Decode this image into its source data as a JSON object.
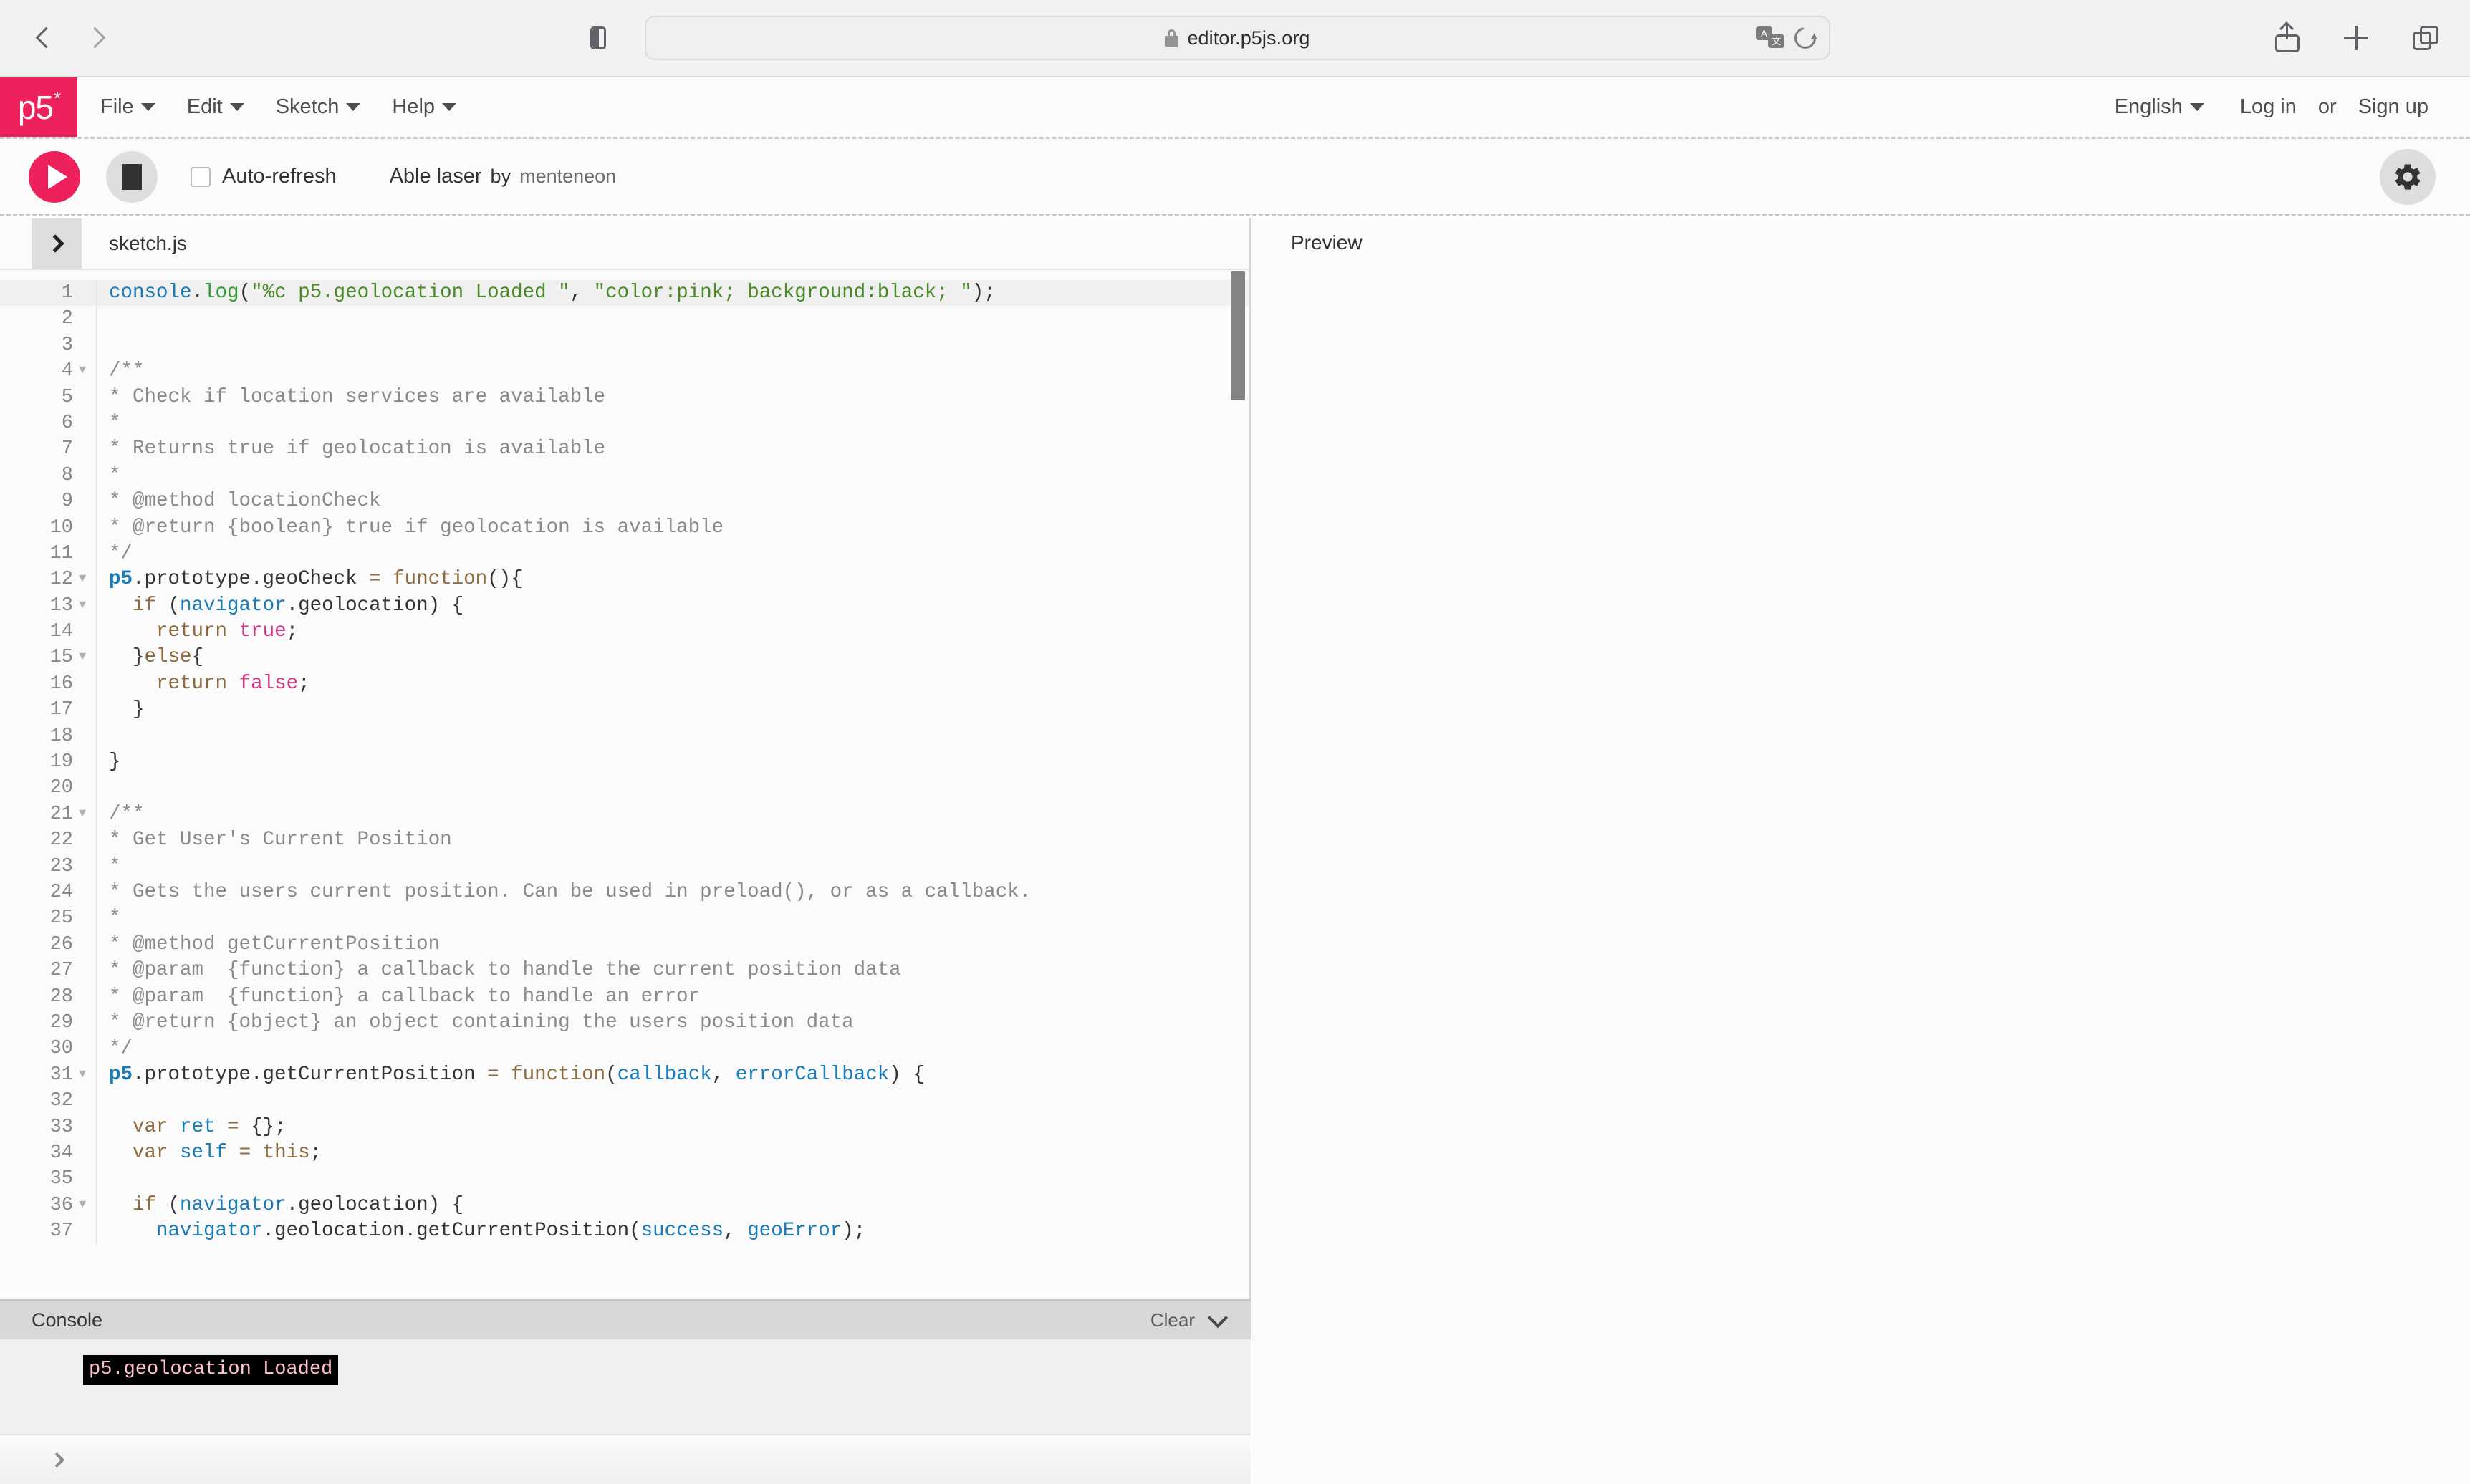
{
  "browser": {
    "url": "editor.p5js.org",
    "back_label": "Back",
    "forward_label": "Forward",
    "sidebar_label": "Show sidebar",
    "share_label": "Share",
    "new_tab_label": "New tab",
    "tabs_label": "Show tabs",
    "translate_label": "Translate",
    "reload_label": "Reload",
    "lock_label": "Secure connection"
  },
  "nav": {
    "logo": "p5",
    "logo_star": "*",
    "menus": [
      {
        "label": "File"
      },
      {
        "label": "Edit"
      },
      {
        "label": "Sketch"
      },
      {
        "label": "Help"
      }
    ],
    "language": "English",
    "login": "Log in",
    "or": "or",
    "signup": "Sign up"
  },
  "toolbar": {
    "play_label": "Play sketch",
    "stop_label": "Stop sketch",
    "autorefresh_label": "Auto-refresh",
    "autorefresh_checked": false,
    "sketch_name": "Able laser",
    "by_label": "by",
    "author": "menteneon",
    "settings_label": "Settings"
  },
  "editor": {
    "expand_label": "Expand file tree",
    "file_name": "sketch.js",
    "lines": [
      {
        "n": 1,
        "fold": false,
        "highlight": true,
        "tokens": [
          {
            "t": "console",
            "c": "t-var"
          },
          {
            "t": ".",
            "c": "t-plain"
          },
          {
            "t": "log",
            "c": "t-fn"
          },
          {
            "t": "(",
            "c": "t-plain"
          },
          {
            "t": "\"%c p5.geolocation Loaded \"",
            "c": "t-str"
          },
          {
            "t": ", ",
            "c": "t-plain"
          },
          {
            "t": "\"color:pink; background:black; \"",
            "c": "t-str"
          },
          {
            "t": ");",
            "c": "t-plain"
          }
        ]
      },
      {
        "n": 2,
        "fold": false,
        "highlight": false,
        "tokens": []
      },
      {
        "n": 3,
        "fold": false,
        "highlight": false,
        "tokens": []
      },
      {
        "n": 4,
        "fold": true,
        "highlight": false,
        "tokens": [
          {
            "t": "/**",
            "c": "t-com"
          }
        ]
      },
      {
        "n": 5,
        "fold": false,
        "highlight": false,
        "tokens": [
          {
            "t": "* Check if location services are available",
            "c": "t-com"
          }
        ]
      },
      {
        "n": 6,
        "fold": false,
        "highlight": false,
        "tokens": [
          {
            "t": "*",
            "c": "t-com"
          }
        ]
      },
      {
        "n": 7,
        "fold": false,
        "highlight": false,
        "tokens": [
          {
            "t": "* Returns true if geolocation is available",
            "c": "t-com"
          }
        ]
      },
      {
        "n": 8,
        "fold": false,
        "highlight": false,
        "tokens": [
          {
            "t": "*",
            "c": "t-com"
          }
        ]
      },
      {
        "n": 9,
        "fold": false,
        "highlight": false,
        "tokens": [
          {
            "t": "* @method locationCheck",
            "c": "t-com"
          }
        ]
      },
      {
        "n": 10,
        "fold": false,
        "highlight": false,
        "tokens": [
          {
            "t": "* @return {boolean} true if geolocation is available",
            "c": "t-com"
          }
        ]
      },
      {
        "n": 11,
        "fold": false,
        "highlight": false,
        "tokens": [
          {
            "t": "*/",
            "c": "t-com"
          }
        ]
      },
      {
        "n": 12,
        "fold": true,
        "highlight": false,
        "tokens": [
          {
            "t": "p5",
            "c": "t-prop"
          },
          {
            "t": ".prototype.geoCheck ",
            "c": "t-plain"
          },
          {
            "t": "=",
            "c": "t-kw"
          },
          {
            "t": " ",
            "c": "t-plain"
          },
          {
            "t": "function",
            "c": "t-kw"
          },
          {
            "t": "(){",
            "c": "t-plain"
          }
        ]
      },
      {
        "n": 13,
        "fold": true,
        "highlight": false,
        "tokens": [
          {
            "t": "  ",
            "c": "t-plain"
          },
          {
            "t": "if",
            "c": "t-kw"
          },
          {
            "t": " (",
            "c": "t-plain"
          },
          {
            "t": "navigator",
            "c": "t-var"
          },
          {
            "t": ".geolocation) {",
            "c": "t-plain"
          }
        ]
      },
      {
        "n": 14,
        "fold": false,
        "highlight": false,
        "tokens": [
          {
            "t": "    ",
            "c": "t-plain"
          },
          {
            "t": "return",
            "c": "t-kw"
          },
          {
            "t": " ",
            "c": "t-plain"
          },
          {
            "t": "true",
            "c": "t-atom"
          },
          {
            "t": ";",
            "c": "t-plain"
          }
        ]
      },
      {
        "n": 15,
        "fold": true,
        "highlight": false,
        "tokens": [
          {
            "t": "  }",
            "c": "t-plain"
          },
          {
            "t": "else",
            "c": "t-kw"
          },
          {
            "t": "{",
            "c": "t-plain"
          }
        ]
      },
      {
        "n": 16,
        "fold": false,
        "highlight": false,
        "tokens": [
          {
            "t": "    ",
            "c": "t-plain"
          },
          {
            "t": "return",
            "c": "t-kw"
          },
          {
            "t": " ",
            "c": "t-plain"
          },
          {
            "t": "false",
            "c": "t-atom"
          },
          {
            "t": ";",
            "c": "t-plain"
          }
        ]
      },
      {
        "n": 17,
        "fold": false,
        "highlight": false,
        "tokens": [
          {
            "t": "  }",
            "c": "t-plain"
          }
        ]
      },
      {
        "n": 18,
        "fold": false,
        "highlight": false,
        "tokens": []
      },
      {
        "n": 19,
        "fold": false,
        "highlight": false,
        "tokens": [
          {
            "t": "}",
            "c": "t-plain"
          }
        ]
      },
      {
        "n": 20,
        "fold": false,
        "highlight": false,
        "tokens": []
      },
      {
        "n": 21,
        "fold": true,
        "highlight": false,
        "tokens": [
          {
            "t": "/**",
            "c": "t-com"
          }
        ]
      },
      {
        "n": 22,
        "fold": false,
        "highlight": false,
        "tokens": [
          {
            "t": "* Get User's Current Position",
            "c": "t-com"
          }
        ]
      },
      {
        "n": 23,
        "fold": false,
        "highlight": false,
        "tokens": [
          {
            "t": "*",
            "c": "t-com"
          }
        ]
      },
      {
        "n": 24,
        "fold": false,
        "highlight": false,
        "tokens": [
          {
            "t": "* Gets the users current position. Can be used in preload(), or as a callback.",
            "c": "t-com"
          }
        ]
      },
      {
        "n": 25,
        "fold": false,
        "highlight": false,
        "tokens": [
          {
            "t": "*",
            "c": "t-com"
          }
        ]
      },
      {
        "n": 26,
        "fold": false,
        "highlight": false,
        "tokens": [
          {
            "t": "* @method getCurrentPosition",
            "c": "t-com"
          }
        ]
      },
      {
        "n": 27,
        "fold": false,
        "highlight": false,
        "tokens": [
          {
            "t": "* @param  {function} a callback to handle the current position data",
            "c": "t-com"
          }
        ]
      },
      {
        "n": 28,
        "fold": false,
        "highlight": false,
        "tokens": [
          {
            "t": "* @param  {function} a callback to handle an error",
            "c": "t-com"
          }
        ]
      },
      {
        "n": 29,
        "fold": false,
        "highlight": false,
        "tokens": [
          {
            "t": "* @return {object} an object containing the users position data",
            "c": "t-com"
          }
        ]
      },
      {
        "n": 30,
        "fold": false,
        "highlight": false,
        "tokens": [
          {
            "t": "*/",
            "c": "t-com"
          }
        ]
      },
      {
        "n": 31,
        "fold": true,
        "highlight": false,
        "tokens": [
          {
            "t": "p5",
            "c": "t-prop"
          },
          {
            "t": ".prototype.getCurrentPosition ",
            "c": "t-plain"
          },
          {
            "t": "=",
            "c": "t-kw"
          },
          {
            "t": " ",
            "c": "t-plain"
          },
          {
            "t": "function",
            "c": "t-kw"
          },
          {
            "t": "(",
            "c": "t-plain"
          },
          {
            "t": "callback",
            "c": "t-var"
          },
          {
            "t": ", ",
            "c": "t-plain"
          },
          {
            "t": "errorCallback",
            "c": "t-var"
          },
          {
            "t": ") {",
            "c": "t-plain"
          }
        ]
      },
      {
        "n": 32,
        "fold": false,
        "highlight": false,
        "tokens": []
      },
      {
        "n": 33,
        "fold": false,
        "highlight": false,
        "tokens": [
          {
            "t": "  ",
            "c": "t-plain"
          },
          {
            "t": "var",
            "c": "t-kw"
          },
          {
            "t": " ",
            "c": "t-plain"
          },
          {
            "t": "ret",
            "c": "t-var"
          },
          {
            "t": " ",
            "c": "t-plain"
          },
          {
            "t": "=",
            "c": "t-kw"
          },
          {
            "t": " {};",
            "c": "t-plain"
          }
        ]
      },
      {
        "n": 34,
        "fold": false,
        "highlight": false,
        "tokens": [
          {
            "t": "  ",
            "c": "t-plain"
          },
          {
            "t": "var",
            "c": "t-kw"
          },
          {
            "t": " ",
            "c": "t-plain"
          },
          {
            "t": "self",
            "c": "t-var"
          },
          {
            "t": " ",
            "c": "t-plain"
          },
          {
            "t": "=",
            "c": "t-kw"
          },
          {
            "t": " ",
            "c": "t-plain"
          },
          {
            "t": "this",
            "c": "t-this"
          },
          {
            "t": ";",
            "c": "t-plain"
          }
        ]
      },
      {
        "n": 35,
        "fold": false,
        "highlight": false,
        "tokens": []
      },
      {
        "n": 36,
        "fold": true,
        "highlight": false,
        "tokens": [
          {
            "t": "  ",
            "c": "t-plain"
          },
          {
            "t": "if",
            "c": "t-kw"
          },
          {
            "t": " (",
            "c": "t-plain"
          },
          {
            "t": "navigator",
            "c": "t-var"
          },
          {
            "t": ".geolocation) {",
            "c": "t-plain"
          }
        ]
      },
      {
        "n": 37,
        "fold": false,
        "highlight": false,
        "tokens": [
          {
            "t": "    ",
            "c": "t-plain"
          },
          {
            "t": "navigator",
            "c": "t-var"
          },
          {
            "t": ".geolocation.getCurrentPosition(",
            "c": "t-plain"
          },
          {
            "t": "success",
            "c": "t-var"
          },
          {
            "t": ", ",
            "c": "t-plain"
          },
          {
            "t": "geoError",
            "c": "t-var"
          },
          {
            "t": ");",
            "c": "t-plain"
          }
        ]
      }
    ]
  },
  "console": {
    "title": "Console",
    "clear_label": "Clear",
    "collapse_label": "Collapse console",
    "messages": [
      {
        "text": "p5.geolocation Loaded",
        "color": "#ffc0cb",
        "background": "#000000"
      }
    ],
    "prompt": ">"
  },
  "preview": {
    "label": "Preview"
  },
  "colors": {
    "brand_pink": "#ed225d",
    "chrome_bg": "#f2f2f2",
    "panel_bg": "#fbfbfb",
    "console_header": "#d8d8d8",
    "console_body": "#efefef"
  }
}
